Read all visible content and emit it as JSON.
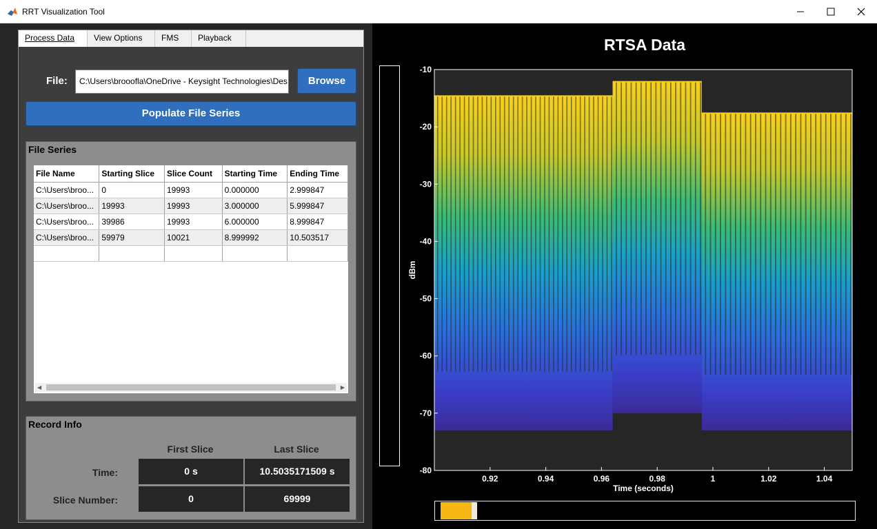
{
  "window": {
    "title": "RRT Visualization Tool",
    "icon": "matlab-icon",
    "controls": [
      "minimize-icon",
      "maximize-icon",
      "close-icon"
    ]
  },
  "tabs": [
    {
      "label": "Process Data",
      "active": true
    },
    {
      "label": "View Options",
      "active": false
    },
    {
      "label": "FMS",
      "active": false
    },
    {
      "label": "Playback",
      "active": false
    }
  ],
  "file": {
    "label": "File:",
    "value": "C:\\Users\\brooofla\\OneDrive - Keysight Technologies\\Des",
    "browse_label": "Browse",
    "populate_label": "Populate File Series"
  },
  "file_series": {
    "title": "File Series",
    "columns": [
      "File Name",
      "Starting Slice",
      "Slice Count",
      "Starting Time",
      "Ending Time"
    ],
    "rows": [
      [
        "C:\\Users\\broo...",
        "0",
        "19993",
        "0.000000",
        "2.999847"
      ],
      [
        "C:\\Users\\broo...",
        "19993",
        "19993",
        "3.000000",
        "5.999847"
      ],
      [
        "C:\\Users\\broo...",
        "39986",
        "19993",
        "6.000000",
        "8.999847"
      ],
      [
        "C:\\Users\\broo...",
        "59979",
        "10021",
        "8.999992",
        "10.503517"
      ]
    ]
  },
  "record_info": {
    "title": "Record Info",
    "col_first": "First Slice",
    "col_last": "Last Slice",
    "time_label": "Time:",
    "time_first": "0 s",
    "time_last": "10.5035171509 s",
    "slice_label": "Slice Number:",
    "slice_first": "0",
    "slice_last": "69999"
  },
  "playback_slider": {
    "position_fraction": 0.05
  },
  "colors": {
    "accent_blue": "#2f6fbd",
    "plot_bg": "#262626",
    "colormap": [
      "#3b2a98",
      "#2a6fdc",
      "#1aa1c8",
      "#3cbc74",
      "#c8c82a",
      "#f8d01c"
    ]
  },
  "chart_data": {
    "type": "area",
    "title": "RTSA Data",
    "xlabel": "Time (seconds)",
    "ylabel": "dBm",
    "xlim": [
      0.9,
      1.05
    ],
    "ylim": [
      -80,
      -10
    ],
    "xticks": [
      "0.92",
      "0.94",
      "0.96",
      "0.98",
      "1",
      "1.02",
      "1.04"
    ],
    "xtick_values": [
      0.92,
      0.94,
      0.96,
      0.98,
      1.0,
      1.02,
      1.04
    ],
    "yticks": [
      "-10",
      "-20",
      "-30",
      "-40",
      "-50",
      "-60",
      "-70",
      "-80"
    ],
    "ytick_values": [
      -10,
      -20,
      -30,
      -40,
      -50,
      -60,
      -70,
      -80
    ],
    "grid": false,
    "colormap": "parula",
    "segments": [
      {
        "x_start": 0.9,
        "x_end": 0.964,
        "peak_dbm": -14.5,
        "floor_dbm": -73,
        "bursts": 40
      },
      {
        "x_start": 0.964,
        "x_end": 0.996,
        "peak_dbm": -12,
        "floor_dbm": -70,
        "bursts": 18
      },
      {
        "x_start": 0.996,
        "x_end": 1.05,
        "peak_dbm": -17.5,
        "floor_dbm": -73,
        "bursts": 30
      }
    ]
  }
}
